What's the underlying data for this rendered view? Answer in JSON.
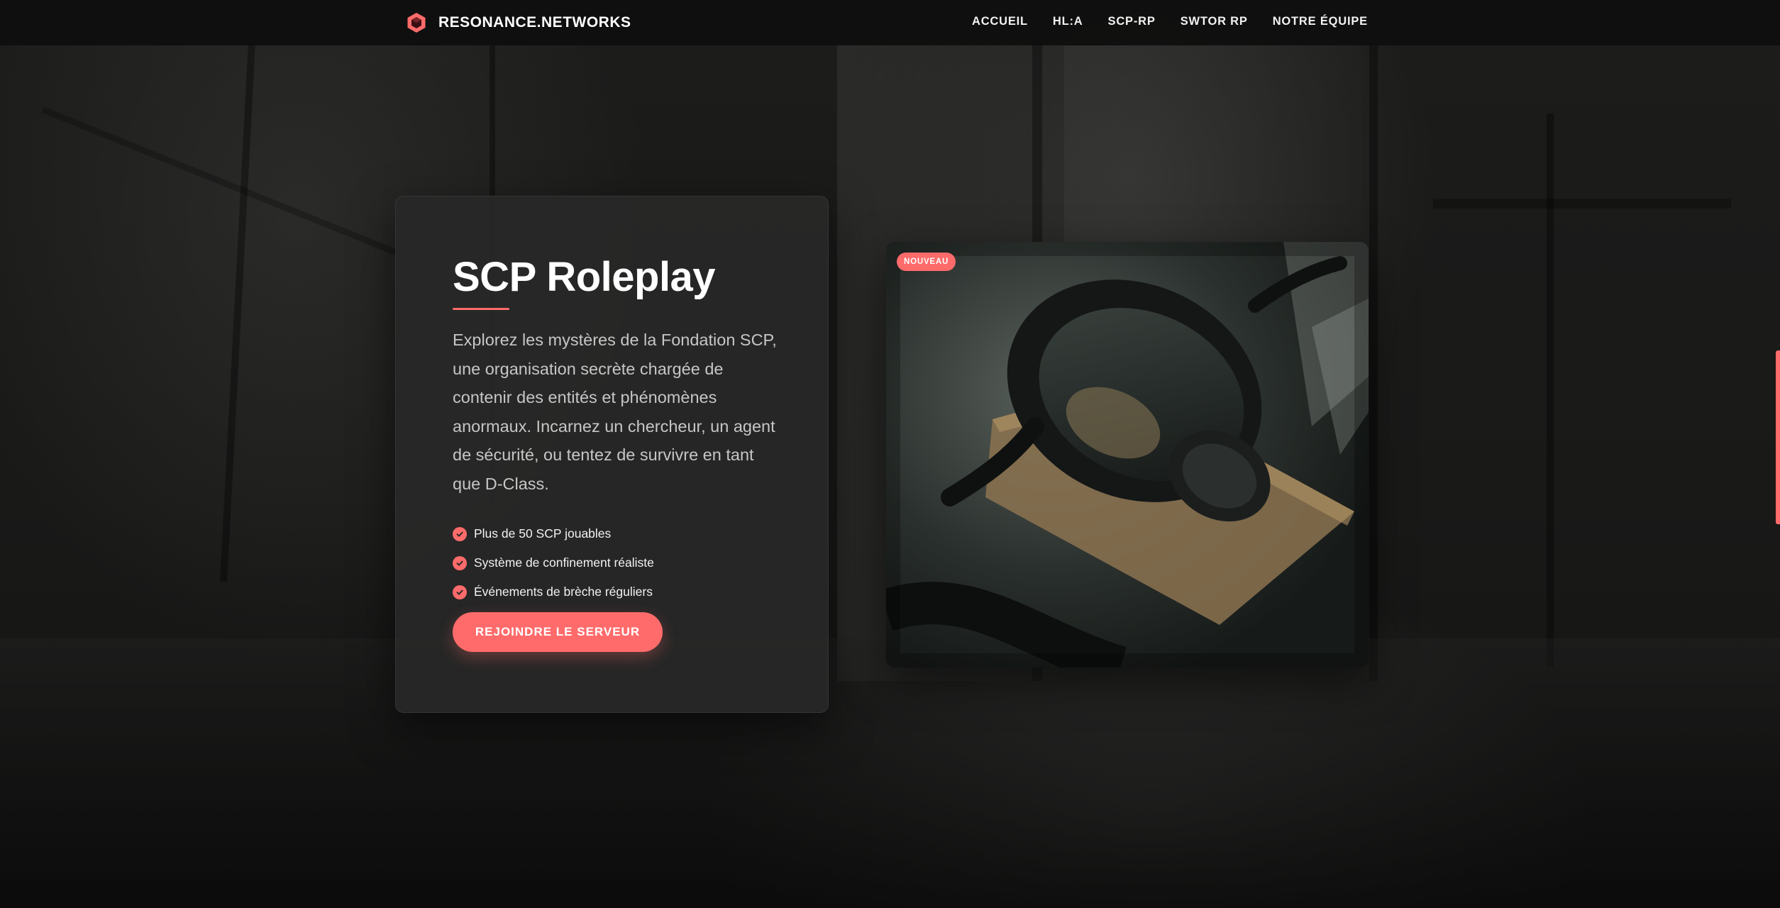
{
  "brand": {
    "name": "RESONANCE.NETWORKS",
    "logo_icon": "hexagon-logo-icon"
  },
  "nav": {
    "items": [
      {
        "label": "ACCUEIL"
      },
      {
        "label": "HL:A"
      },
      {
        "label": "SCP-RP"
      },
      {
        "label": "SWTOR RP"
      },
      {
        "label": "NOTRE ÉQUIPE"
      }
    ]
  },
  "hero": {
    "title": "SCP Roleplay",
    "description": "Explorez les mystères de la Fondation SCP, une organisation secrète chargée de contenir des entités et phénomènes anormaux. Incarnez un chercheur, un agent de sécurité, ou tentez de survivre en tant que D-Class.",
    "features": [
      {
        "label": "Plus de 50 SCP jouables",
        "icon": "check-circle-icon"
      },
      {
        "label": "Système de confinement réaliste",
        "icon": "check-circle-icon"
      },
      {
        "label": "Événements de brèche réguliers",
        "icon": "check-circle-icon"
      }
    ],
    "cta_label": "REJOINDRE LE SERVEUR",
    "image_badge": "NOUVEAU",
    "image_subject": "gas-mask-photo"
  },
  "colors": {
    "accent": "#ff6b6b",
    "nav_background": "#0e0e0e",
    "card_background": "#282828",
    "body_text": "#c6c6c6"
  }
}
